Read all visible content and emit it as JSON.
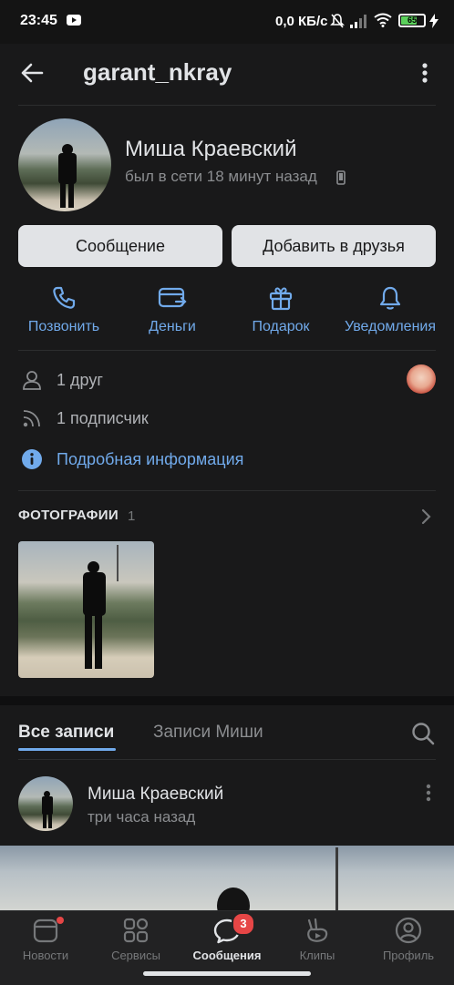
{
  "status_bar": {
    "time": "23:45",
    "network_speed": "0,0 КБ/с",
    "battery_level": "65"
  },
  "header": {
    "title": "garant_nkray",
    "back_icon": "arrow-left-icon",
    "menu_icon": "more-vertical-icon"
  },
  "profile": {
    "name": "Миша Краевский",
    "last_seen": "был в сети 18 минут назад",
    "message_button": "Сообщение",
    "add_friend_button": "Добавить в друзья"
  },
  "actions": [
    {
      "label": "Позвонить",
      "icon": "phone-icon"
    },
    {
      "label": "Деньги",
      "icon": "money-card-icon"
    },
    {
      "label": "Подарок",
      "icon": "gift-icon"
    },
    {
      "label": "Уведомления",
      "icon": "bell-icon"
    }
  ],
  "info": {
    "friends": "1 друг",
    "followers": "1 подписчик",
    "details_link": "Подробная информация"
  },
  "photos": {
    "title": "ФОТОГРАФИИ",
    "count": "1"
  },
  "wall": {
    "tabs": [
      "Все записи",
      "Записи Миши"
    ],
    "active_tab": "Все записи"
  },
  "post": {
    "author": "Миша Краевский",
    "time": "три часа назад"
  },
  "bottom_nav": {
    "items": [
      {
        "label": "Новости",
        "icon": "news-icon",
        "has_dot": true
      },
      {
        "label": "Сервисы",
        "icon": "services-grid-icon"
      },
      {
        "label": "Сообщения",
        "icon": "messages-icon",
        "badge": "3",
        "active": true
      },
      {
        "label": "Клипы",
        "icon": "clips-icon"
      },
      {
        "label": "Профиль",
        "icon": "profile-icon"
      }
    ]
  },
  "colors": {
    "background": "#19191a",
    "accent": "#71aaeb",
    "button_bg": "#e1e3e6",
    "badge": "#e64646"
  }
}
